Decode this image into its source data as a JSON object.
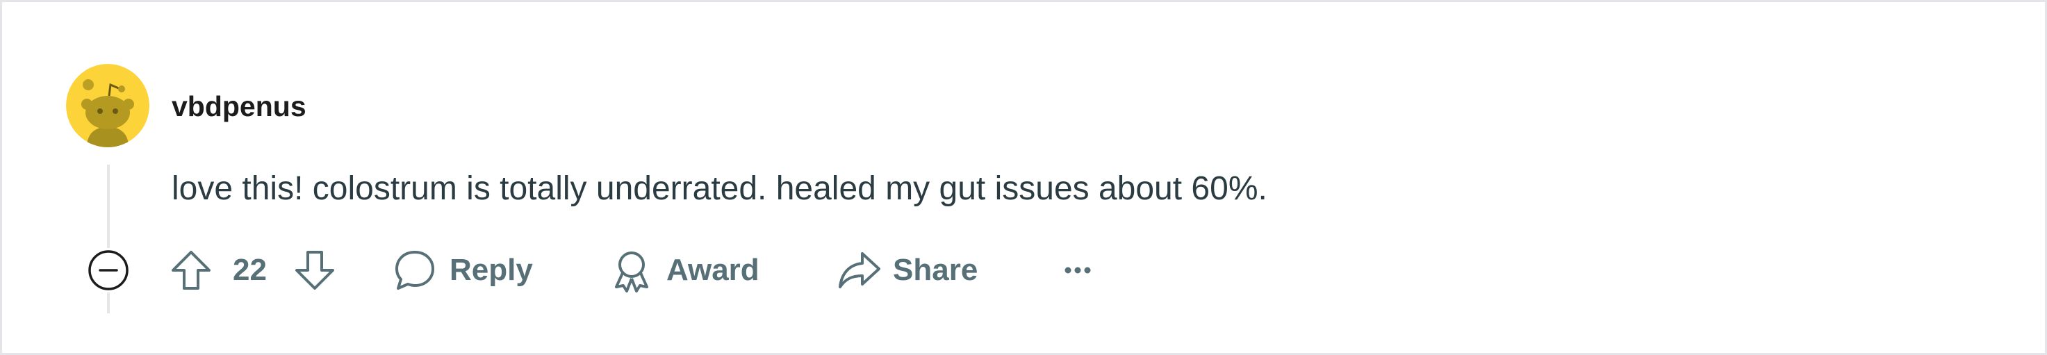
{
  "comment": {
    "author": "vbdpenus",
    "body": "love this! colostrum is totally underrated. healed my gut issues about 60%.",
    "score": "22"
  },
  "actions": {
    "reply_label": "Reply",
    "award_label": "Award",
    "share_label": "Share"
  },
  "icons": {
    "avatar": "reddit-snoo-avatar",
    "collapse": "minus-circle-icon",
    "upvote": "arrow-up-icon",
    "downvote": "arrow-down-icon",
    "reply": "speech-bubble-icon",
    "award": "award-ribbon-icon",
    "share": "share-arrow-icon",
    "more": "ellipsis-icon"
  },
  "colors": {
    "avatar_bg": "#fdd33a",
    "action_text": "#576f76",
    "body_text": "#2a3c42",
    "thread_line": "#e4e6e8"
  }
}
